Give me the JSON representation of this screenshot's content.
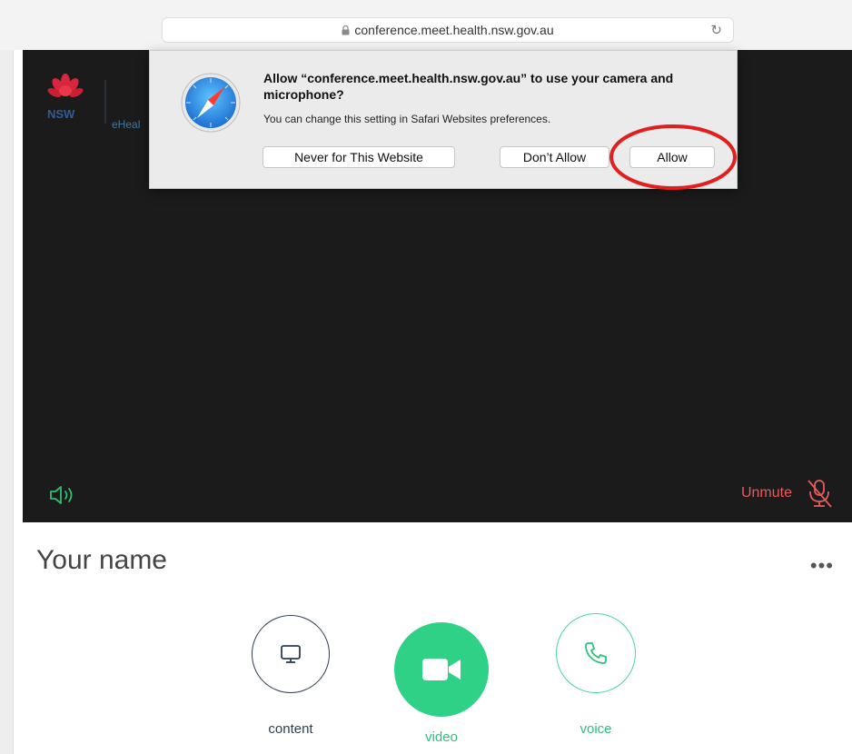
{
  "browser": {
    "url": "conference.meet.health.nsw.gov.au"
  },
  "branding": {
    "nsw": "NSW",
    "ehealth": "eHeal"
  },
  "permission_dialog": {
    "title": "Allow “conference.meet.health.nsw.gov.au” to use your camera and microphone?",
    "subtitle": "You can change this setting in Safari Websites preferences.",
    "never_label": "Never for This Website",
    "dont_allow_label": "Don’t Allow",
    "allow_label": "Allow"
  },
  "video_area": {
    "unmute_label": "Unmute"
  },
  "participant": {
    "name_label": "Your name",
    "more_label": "•••"
  },
  "controls": {
    "content_label": "content",
    "video_label": "video",
    "voice_label": "voice"
  },
  "colors": {
    "accent_green": "#2fd187",
    "mute_red": "#e85a5a",
    "highlight_red": "#e01f1f"
  }
}
